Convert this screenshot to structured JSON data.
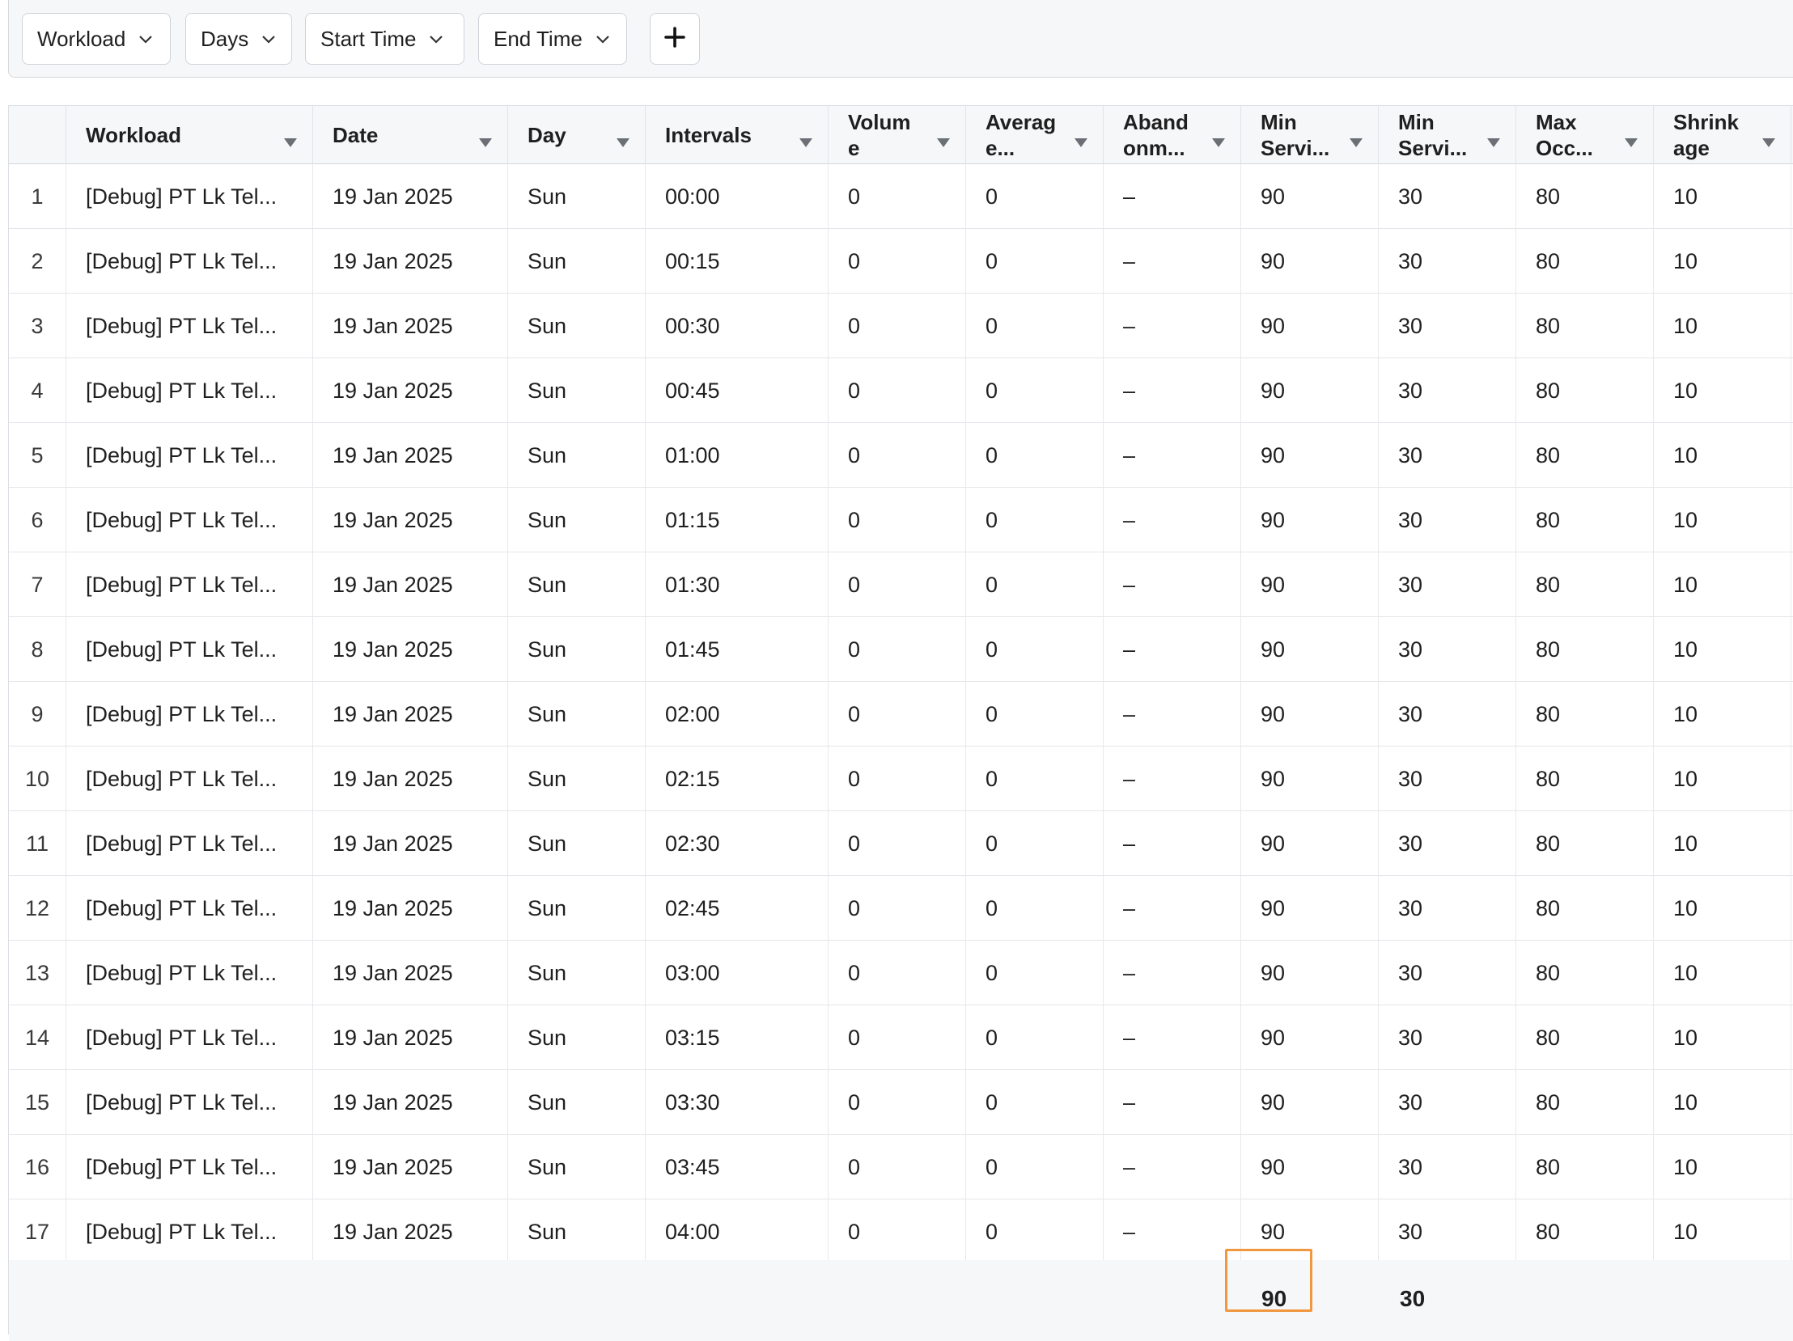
{
  "filters": {
    "workload": "Workload",
    "days": "Days",
    "start_time": "Start Time",
    "end_time": "End Time",
    "add_icon": "plus-icon"
  },
  "columns": [
    {
      "key": "workload",
      "label": "Workload"
    },
    {
      "key": "date",
      "label": "Date"
    },
    {
      "key": "day",
      "label": "Day"
    },
    {
      "key": "intervals",
      "label": "Intervals"
    },
    {
      "key": "volume",
      "label": "Volum\ne"
    },
    {
      "key": "average",
      "label": "Averag\ne..."
    },
    {
      "key": "abandonment",
      "label": "Aband\nonm..."
    },
    {
      "key": "min_service_1",
      "label": "Min\nServi..."
    },
    {
      "key": "min_service_2",
      "label": "Min\nServi..."
    },
    {
      "key": "max_occ",
      "label": "Max\nOcc..."
    },
    {
      "key": "shrinkage",
      "label": "Shrink\nage"
    }
  ],
  "rows": [
    {
      "n": "1",
      "workload": "[Debug] PT Lk Tel...",
      "date": "19 Jan 2025",
      "day": "Sun",
      "intervals": "00:00",
      "volume": "0",
      "average": "0",
      "abandonment": "–",
      "min_service_1": "90",
      "min_service_2": "30",
      "max_occ": "80",
      "shrinkage": "10"
    },
    {
      "n": "2",
      "workload": "[Debug] PT Lk Tel...",
      "date": "19 Jan 2025",
      "day": "Sun",
      "intervals": "00:15",
      "volume": "0",
      "average": "0",
      "abandonment": "–",
      "min_service_1": "90",
      "min_service_2": "30",
      "max_occ": "80",
      "shrinkage": "10"
    },
    {
      "n": "3",
      "workload": "[Debug] PT Lk Tel...",
      "date": "19 Jan 2025",
      "day": "Sun",
      "intervals": "00:30",
      "volume": "0",
      "average": "0",
      "abandonment": "–",
      "min_service_1": "90",
      "min_service_2": "30",
      "max_occ": "80",
      "shrinkage": "10"
    },
    {
      "n": "4",
      "workload": "[Debug] PT Lk Tel...",
      "date": "19 Jan 2025",
      "day": "Sun",
      "intervals": "00:45",
      "volume": "0",
      "average": "0",
      "abandonment": "–",
      "min_service_1": "90",
      "min_service_2": "30",
      "max_occ": "80",
      "shrinkage": "10"
    },
    {
      "n": "5",
      "workload": "[Debug] PT Lk Tel...",
      "date": "19 Jan 2025",
      "day": "Sun",
      "intervals": "01:00",
      "volume": "0",
      "average": "0",
      "abandonment": "–",
      "min_service_1": "90",
      "min_service_2": "30",
      "max_occ": "80",
      "shrinkage": "10"
    },
    {
      "n": "6",
      "workload": "[Debug] PT Lk Tel...",
      "date": "19 Jan 2025",
      "day": "Sun",
      "intervals": "01:15",
      "volume": "0",
      "average": "0",
      "abandonment": "–",
      "min_service_1": "90",
      "min_service_2": "30",
      "max_occ": "80",
      "shrinkage": "10"
    },
    {
      "n": "7",
      "workload": "[Debug] PT Lk Tel...",
      "date": "19 Jan 2025",
      "day": "Sun",
      "intervals": "01:30",
      "volume": "0",
      "average": "0",
      "abandonment": "–",
      "min_service_1": "90",
      "min_service_2": "30",
      "max_occ": "80",
      "shrinkage": "10"
    },
    {
      "n": "8",
      "workload": "[Debug] PT Lk Tel...",
      "date": "19 Jan 2025",
      "day": "Sun",
      "intervals": "01:45",
      "volume": "0",
      "average": "0",
      "abandonment": "–",
      "min_service_1": "90",
      "min_service_2": "30",
      "max_occ": "80",
      "shrinkage": "10"
    },
    {
      "n": "9",
      "workload": "[Debug] PT Lk Tel...",
      "date": "19 Jan 2025",
      "day": "Sun",
      "intervals": "02:00",
      "volume": "0",
      "average": "0",
      "abandonment": "–",
      "min_service_1": "90",
      "min_service_2": "30",
      "max_occ": "80",
      "shrinkage": "10"
    },
    {
      "n": "10",
      "workload": "[Debug] PT Lk Tel...",
      "date": "19 Jan 2025",
      "day": "Sun",
      "intervals": "02:15",
      "volume": "0",
      "average": "0",
      "abandonment": "–",
      "min_service_1": "90",
      "min_service_2": "30",
      "max_occ": "80",
      "shrinkage": "10"
    },
    {
      "n": "11",
      "workload": "[Debug] PT Lk Tel...",
      "date": "19 Jan 2025",
      "day": "Sun",
      "intervals": "02:30",
      "volume": "0",
      "average": "0",
      "abandonment": "–",
      "min_service_1": "90",
      "min_service_2": "30",
      "max_occ": "80",
      "shrinkage": "10"
    },
    {
      "n": "12",
      "workload": "[Debug] PT Lk Tel...",
      "date": "19 Jan 2025",
      "day": "Sun",
      "intervals": "02:45",
      "volume": "0",
      "average": "0",
      "abandonment": "–",
      "min_service_1": "90",
      "min_service_2": "30",
      "max_occ": "80",
      "shrinkage": "10"
    },
    {
      "n": "13",
      "workload": "[Debug] PT Lk Tel...",
      "date": "19 Jan 2025",
      "day": "Sun",
      "intervals": "03:00",
      "volume": "0",
      "average": "0",
      "abandonment": "–",
      "min_service_1": "90",
      "min_service_2": "30",
      "max_occ": "80",
      "shrinkage": "10"
    },
    {
      "n": "14",
      "workload": "[Debug] PT Lk Tel...",
      "date": "19 Jan 2025",
      "day": "Sun",
      "intervals": "03:15",
      "volume": "0",
      "average": "0",
      "abandonment": "–",
      "min_service_1": "90",
      "min_service_2": "30",
      "max_occ": "80",
      "shrinkage": "10"
    },
    {
      "n": "15",
      "workload": "[Debug] PT Lk Tel...",
      "date": "19 Jan 2025",
      "day": "Sun",
      "intervals": "03:30",
      "volume": "0",
      "average": "0",
      "abandonment": "–",
      "min_service_1": "90",
      "min_service_2": "30",
      "max_occ": "80",
      "shrinkage": "10"
    },
    {
      "n": "16",
      "workload": "[Debug] PT Lk Tel...",
      "date": "19 Jan 2025",
      "day": "Sun",
      "intervals": "03:45",
      "volume": "0",
      "average": "0",
      "abandonment": "–",
      "min_service_1": "90",
      "min_service_2": "30",
      "max_occ": "80",
      "shrinkage": "10"
    },
    {
      "n": "17",
      "workload": "[Debug] PT Lk Tel...",
      "date": "19 Jan 2025",
      "day": "Sun",
      "intervals": "04:00",
      "volume": "0",
      "average": "0",
      "abandonment": "–",
      "min_service_1": "90",
      "min_service_2": "30",
      "max_occ": "80",
      "shrinkage": "10"
    }
  ],
  "footer": {
    "min_service_1_total": "90",
    "min_service_2_total": "30"
  },
  "colors": {
    "highlight": "#f0973f",
    "header_bg": "#f6f7f9"
  }
}
